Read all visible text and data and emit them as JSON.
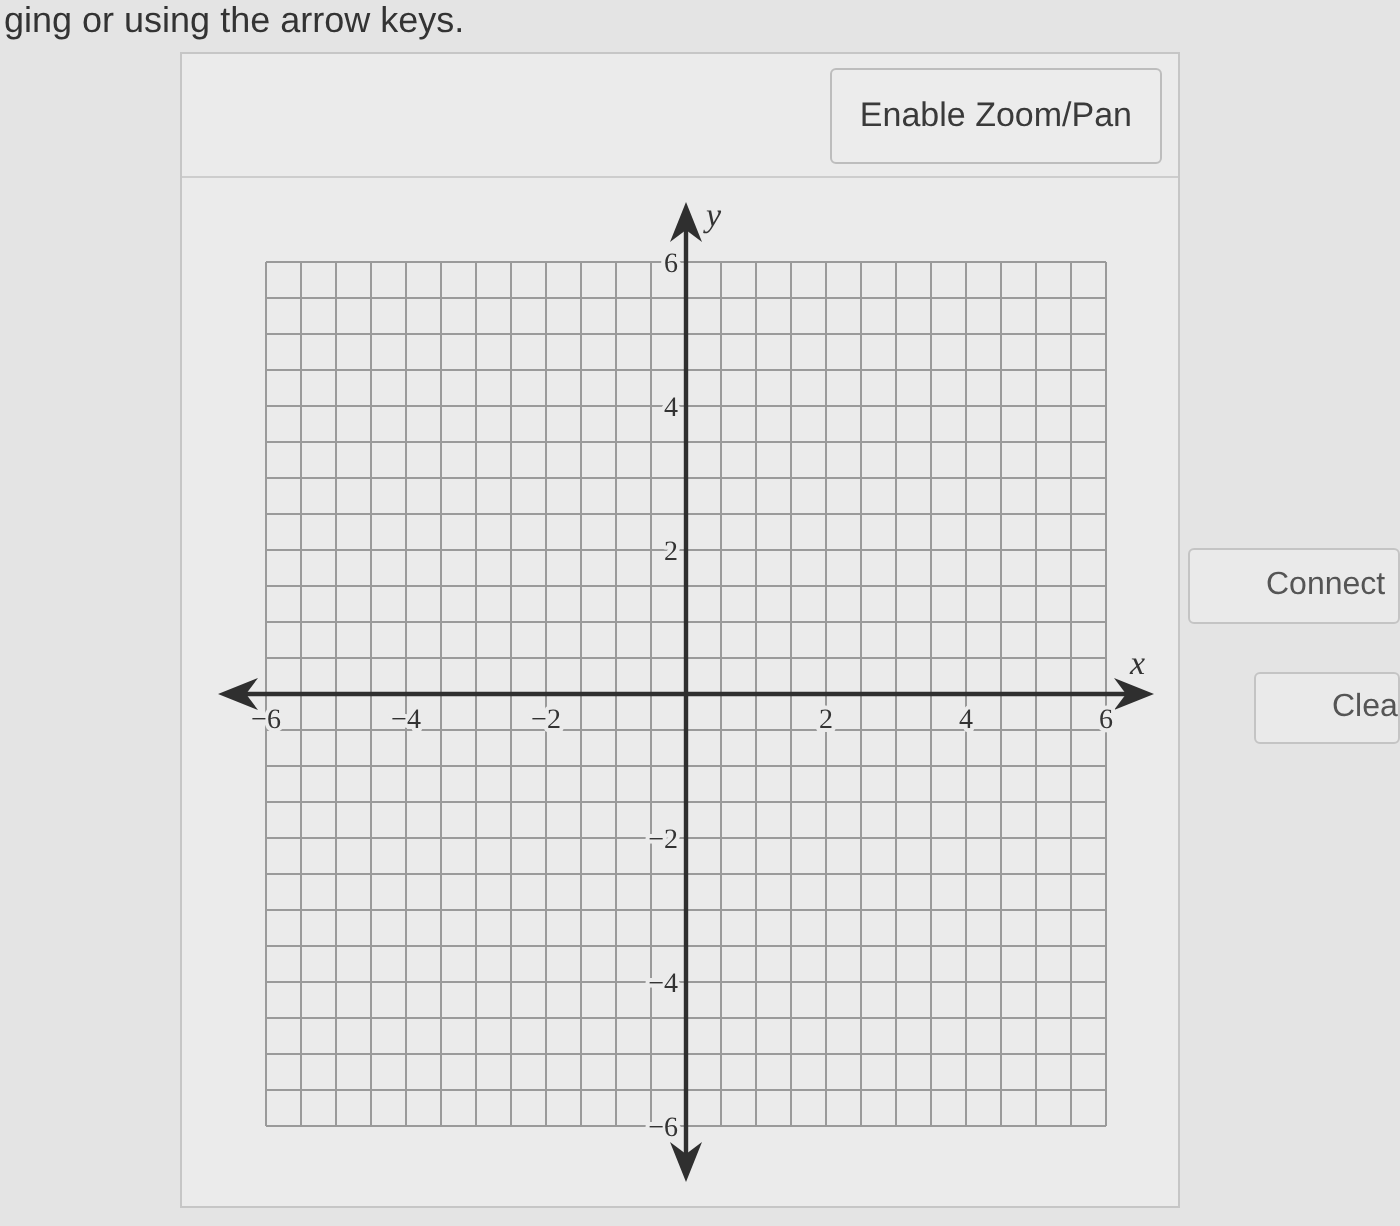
{
  "instruction": {
    "text": "ging or using the arrow keys."
  },
  "toolbar": {
    "buttons": [
      {
        "label": "Enable Zoom/Pan"
      }
    ]
  },
  "graph": {
    "chart_data": {
      "type": "scatter",
      "grid": true,
      "xlabel": "x",
      "ylabel": "y",
      "xlim": [
        -6,
        6
      ],
      "ylim": [
        -6,
        6
      ],
      "xticks": [
        {
          "value": -6,
          "label": "−6"
        },
        {
          "value": -4,
          "label": "−4"
        },
        {
          "value": -2,
          "label": "−2"
        },
        {
          "value": 2,
          "label": "2"
        },
        {
          "value": 4,
          "label": "4"
        },
        {
          "value": 6,
          "label": "6"
        }
      ],
      "yticks": [
        {
          "value": 6,
          "label": "6"
        },
        {
          "value": 4,
          "label": "4"
        },
        {
          "value": 2,
          "label": "2"
        },
        {
          "value": -2,
          "label": "−2"
        },
        {
          "value": -4,
          "label": "−4"
        },
        {
          "value": -6,
          "label": "−6"
        }
      ]
    }
  },
  "side_buttons": [
    {
      "label": "Connect"
    },
    {
      "label": "Clea"
    }
  ]
}
